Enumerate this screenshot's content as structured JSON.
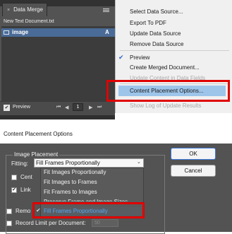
{
  "data_merge_panel": {
    "tab_title": "Data Merge",
    "close_glyph": "×",
    "source_file": "New Text Document.txt",
    "fields": [
      {
        "name": "image",
        "type": "A"
      }
    ],
    "preview_label": "Preview",
    "page_number": "1",
    "nav": {
      "first": "⏮",
      "prev": "◀",
      "next": "▶",
      "last": "⏭"
    }
  },
  "flyout_menu": {
    "items": [
      {
        "label": "Select Data Source..."
      },
      {
        "label": "Export To PDF"
      },
      {
        "label": "Update Data Source"
      },
      {
        "label": "Remove Data Source"
      },
      {
        "label": "Preview",
        "checked": true
      },
      {
        "label": "Create Merged Document..."
      },
      {
        "label": "Update Content in Data Fields",
        "disabled": true
      },
      {
        "label": "Content Placement Options...",
        "highlighted": true
      },
      {
        "label": "Show Log of Update Results",
        "disabled": true
      }
    ],
    "check_glyph": "✔"
  },
  "dialog": {
    "title": "Content Placement Options",
    "group_label": "Image Placement",
    "fitting_label": "Fitting:",
    "fitting_value": "Fill Frames Proportionally",
    "chevron": "⌄",
    "center_label": "Cent",
    "link_label": "Link",
    "remove_label": "Remo",
    "record_limit_label": "Record Limit per Document:",
    "record_limit_value": "50",
    "ok_label": "OK",
    "cancel_label": "Cancel",
    "dropdown_options": [
      "Fit Images Proportionally",
      "Fit Images to Frames",
      "Fit Frames to Images",
      "Preserve Frame and Image Sizes",
      "Fill Frames Proportionally"
    ],
    "selected_index": 4
  },
  "colors": {
    "panel_bg": "#535353",
    "menu_highlight": "#9dc5ea",
    "selection_row": "#4a6b97",
    "callout_red": "#e00000",
    "selected_option_text": "#58a6f0"
  }
}
